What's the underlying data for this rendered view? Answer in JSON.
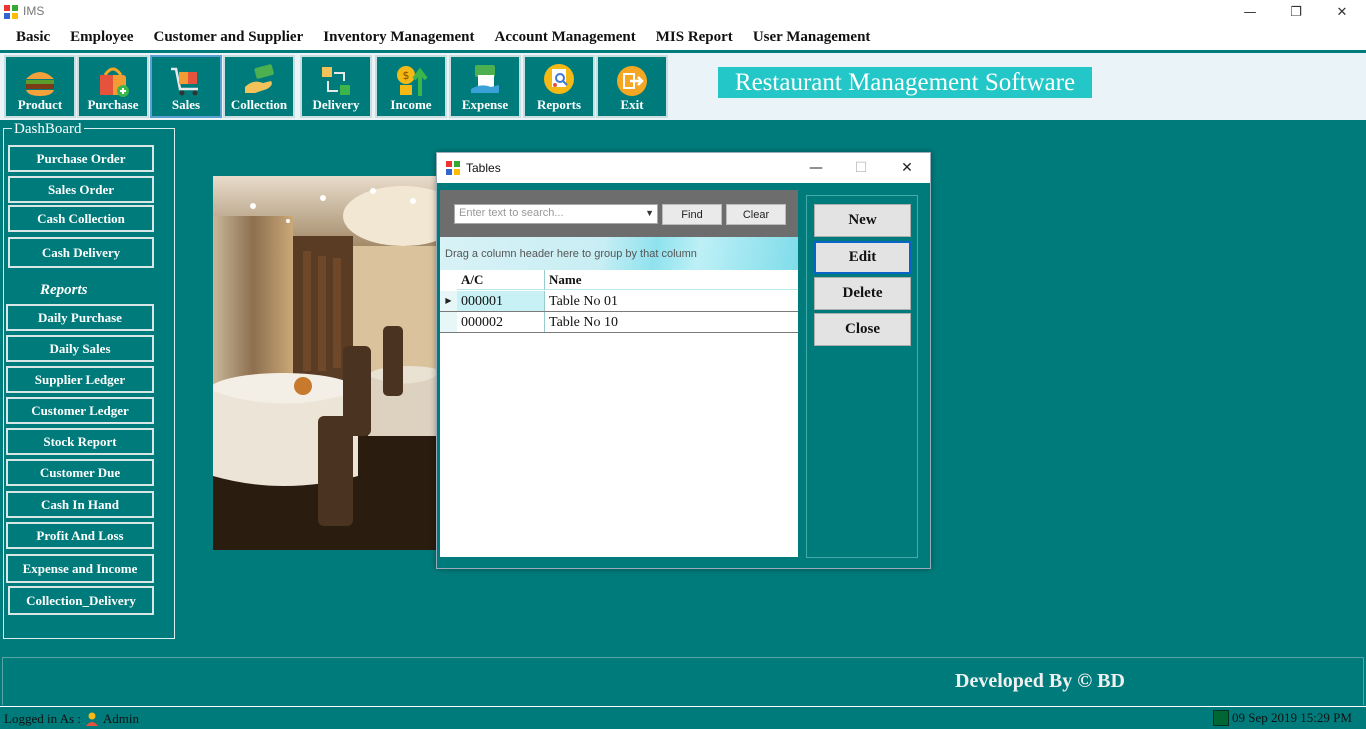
{
  "window": {
    "title": "IMS",
    "controls": {
      "minimize": "—",
      "restore": "❐",
      "close": "✕"
    }
  },
  "menu": [
    "Basic",
    "Employee",
    "Customer and Supplier",
    "Inventory Management",
    "Account Management",
    "MIS Report",
    "User Management"
  ],
  "toolbar": {
    "buttons": [
      {
        "label": "Product",
        "icon": "burger-icon"
      },
      {
        "label": "Purchase",
        "icon": "shopping-bag-icon"
      },
      {
        "label": "Sales",
        "icon": "cart-icon"
      },
      {
        "label": "Collection",
        "icon": "cash-hand-icon"
      },
      {
        "label": "Delivery",
        "icon": "delivery-icon"
      },
      {
        "label": "Income",
        "icon": "income-icon"
      },
      {
        "label": "Expense",
        "icon": "expense-icon"
      },
      {
        "label": "Reports",
        "icon": "report-icon"
      },
      {
        "label": "Exit",
        "icon": "exit-icon"
      }
    ],
    "active": "Sales",
    "brand": "Restaurant Management Software"
  },
  "dashboard": {
    "title": "DashBoard",
    "buttons": [
      "Purchase Order",
      "Sales Order",
      "Cash Collection",
      "Cash Delivery"
    ],
    "reports_label": "Reports",
    "report_buttons": [
      "Daily Purchase",
      "Daily Sales",
      "Supplier Ledger",
      "Customer Ledger",
      "Stock Report",
      "Customer Due",
      "Cash In Hand",
      "Profit And Loss",
      "Expense and  Income",
      "Collection_Delivery"
    ]
  },
  "dialog": {
    "title": "Tables",
    "controls": {
      "minimize": "—",
      "maximize": "☐",
      "close": "✕"
    },
    "search": {
      "placeholder": "Enter text to search...",
      "find_label": "Find",
      "clear_label": "Clear"
    },
    "group_hint": "Drag a column header here to group by that column",
    "columns": [
      "A/C",
      "Name"
    ],
    "rows": [
      {
        "ac": "000001",
        "name": "Table No 01"
      },
      {
        "ac": "000002",
        "name": "Table No 10"
      }
    ],
    "actions": [
      "New",
      "Edit",
      "Delete",
      "Close"
    ]
  },
  "footer": {
    "developed_by": "Developed By © BD"
  },
  "status": {
    "logged_in_label": "Logged in As :",
    "user": "Admin",
    "datetime": "09 Sep 2019 15:29 PM"
  }
}
